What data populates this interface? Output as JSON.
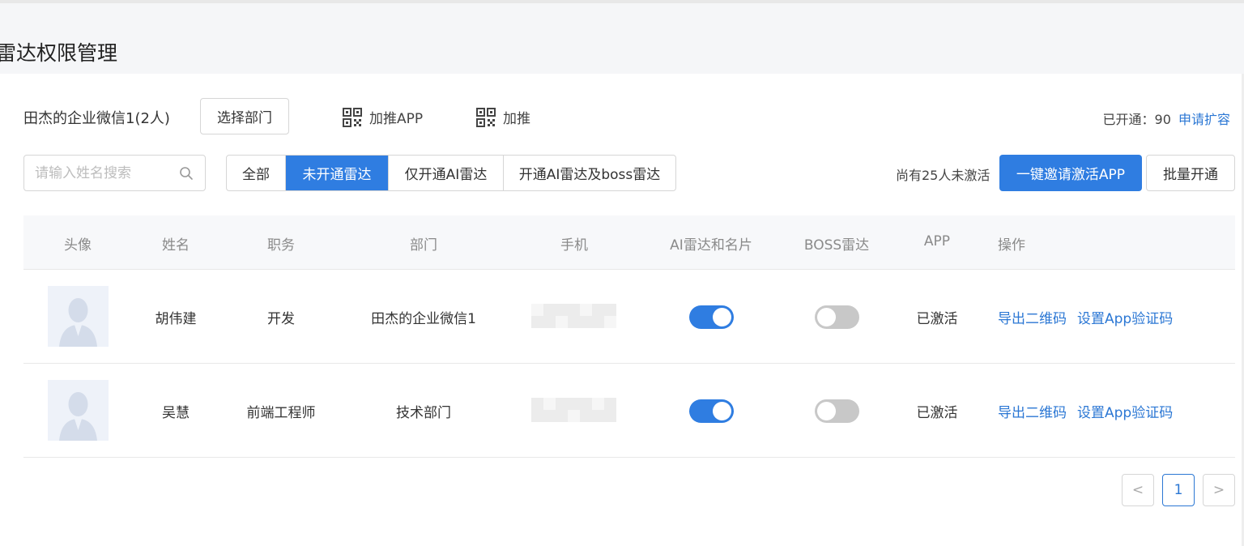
{
  "page": {
    "title": "雷达权限管理"
  },
  "toolbar": {
    "org_name": "田杰的企业微信1(2人)",
    "select_dept_label": "选择部门",
    "push_app_label": "加推APP",
    "push_label": "加推",
    "quota_text": "已开通：90",
    "apply_expand_label": "申请扩容"
  },
  "filters": {
    "search_placeholder": "请输入姓名搜索",
    "tabs": [
      {
        "label": "全部",
        "active": false
      },
      {
        "label": "未开通雷达",
        "active": true
      },
      {
        "label": "仅开通AI雷达",
        "active": false
      },
      {
        "label": "开通AI雷达及boss雷达",
        "active": false
      }
    ],
    "inactive_note": "尚有25人未激活",
    "invite_button_label": "一键邀请激活APP",
    "batch_open_label": "批量开通"
  },
  "table": {
    "headers": [
      "头像",
      "姓名",
      "职务",
      "部门",
      "手机",
      "AI雷达和名片",
      "BOSS雷达",
      "APP",
      "操作"
    ],
    "rows": [
      {
        "name": "胡伟建",
        "title": "开发",
        "dept": "田杰的企业微信1",
        "ai_radar": true,
        "boss_radar": false,
        "app": "已激活",
        "actions": [
          "导出二维码",
          "设置App验证码"
        ]
      },
      {
        "name": "吴慧",
        "title": "前端工程师",
        "dept": "技术部门",
        "ai_radar": true,
        "boss_radar": false,
        "app": "已激活",
        "actions": [
          "导出二维码",
          "设置App验证码"
        ]
      }
    ]
  },
  "pagination": {
    "prev": "<",
    "current_page": "1",
    "next": ">"
  },
  "colors": {
    "primary": "#2f7de1",
    "link": "#2b77d4"
  }
}
